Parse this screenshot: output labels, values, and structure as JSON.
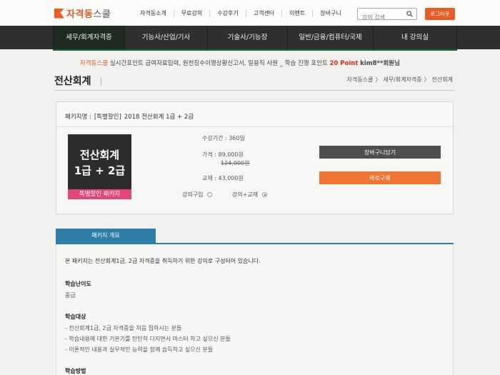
{
  "header": {
    "logo_main": "자격동",
    "logo_sub": "스쿨",
    "nav": [
      "자격동소개",
      "무료강의",
      "수강후기",
      "고객센터",
      "이벤트",
      "장바구니"
    ],
    "search_placeholder": "강의 검색",
    "logout_label": "로그아웃"
  },
  "main_nav": [
    {
      "label": "세무/회계자격증",
      "active": true
    },
    {
      "label": "기능사/산업/기사",
      "active": false
    },
    {
      "label": "기술사/기능장",
      "active": false
    },
    {
      "label": "일반/금융/컴퓨터/국제",
      "active": false
    },
    {
      "label": "내 강의실",
      "active": false
    }
  ],
  "ticker": {
    "brand": "자격동스쿨",
    "text": "실시간포인트 급여자료입력, 원천징수이행상황신고서, 일용직 사원 _ 학습 진행 포인트",
    "points": "20 Point",
    "user": "kim8**회원님"
  },
  "page": {
    "title": "전산회계",
    "breadcrumb": [
      "자격동스쿨",
      "〉",
      "세무/회계자격증",
      "〉",
      "전산회계"
    ]
  },
  "package": {
    "name_label": "패키지명 :",
    "name_tag": "[특별할인]",
    "name": "2018 전산회계 1급 + 2급",
    "thumb_line1": "전산회계",
    "thumb_line2": "1급 + 2급",
    "thumb_tag": "특별할인 패키지",
    "period": "수강기간 : 360일",
    "price": "가격 : 89,000원",
    "original_price": "124,000원",
    "textbook": "교재 : 43,000원",
    "option_lecture": "강의구입",
    "option_lecture_book": "강의+교재",
    "selected_option": "강의+교재",
    "cart_label": "장바구니담기",
    "buy_label": "바로구매"
  },
  "overview": {
    "tab_label": "패키지 개요",
    "intro": "본 패키지는 전산회계1급, 2급 자격증을 취득하기 위한 강의로 구성되어 있습니다.",
    "difficulty_heading": "학습난이도",
    "difficulty_value": "중급",
    "target_heading": "학습대상",
    "targets": [
      "- 전산회계1급, 2급 자격증을 처음 접하시는 분들",
      "- 학습내용에 대한 기본기를 탄탄히 다지면서 마스터 하고 싶으신 분들",
      "- 이론적인 내용과 실무적인 능력을 함께 습득하고 싶으신 분들"
    ],
    "method_heading": "학습방법"
  },
  "colors": {
    "brand": "#e85d26",
    "nav_bg": "#2e2f2e",
    "nav_accent": "#0d6b35",
    "cart_button": "#4e4e4e",
    "buy_button": "#f07530",
    "overview_tab": "#2e7fa8",
    "thumb_tag": "#e4467b"
  }
}
